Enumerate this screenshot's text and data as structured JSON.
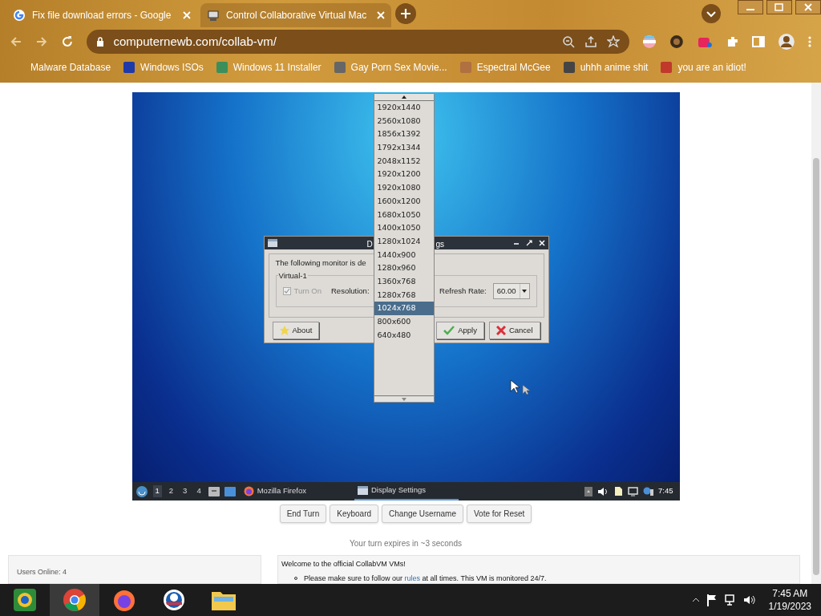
{
  "browser": {
    "tabs": [
      {
        "title": "Fix file download errors - Google",
        "selected": false
      },
      {
        "title": "Control Collaborative Virtual Mac",
        "selected": true
      }
    ],
    "url": "computernewb.com/collab-vm/",
    "bookmarks": [
      "Malware Database",
      "Windows ISOs",
      "Windows 11 Installer",
      "Gay Porn Sex Movie...",
      "Espectral McGee",
      "uhhh anime shit",
      "you are an idiot!"
    ]
  },
  "vm": {
    "dialog": {
      "title_fragments": [
        "D",
        "gs"
      ],
      "message": "The following monitor is de",
      "group": "Virtual-1",
      "turn_on": {
        "label": "Turn On",
        "checked": true,
        "disabled": true
      },
      "resolution_label": "Resolution:",
      "refresh_label": "Refresh Rate:",
      "refresh_value": "60.00",
      "buttons": [
        {
          "kind": "about",
          "label": "About"
        },
        {
          "kind": "apply",
          "label": "Apply"
        },
        {
          "kind": "cancel",
          "label": "Cancel"
        }
      ]
    },
    "resolution_list": [
      {
        "label": "1920x1440",
        "selected": false
      },
      {
        "label": "2560x1080",
        "selected": false
      },
      {
        "label": "1856x1392",
        "selected": false
      },
      {
        "label": "1792x1344",
        "selected": false
      },
      {
        "label": "2048x1152",
        "selected": false
      },
      {
        "label": "1920x1200",
        "selected": false
      },
      {
        "label": "1920x1080",
        "selected": false
      },
      {
        "label": "1600x1200",
        "selected": false
      },
      {
        "label": "1680x1050",
        "selected": false
      },
      {
        "label": "1400x1050",
        "selected": false
      },
      {
        "label": "1280x1024",
        "selected": false
      },
      {
        "label": "1440x900",
        "selected": false
      },
      {
        "label": "1280x960",
        "selected": false
      },
      {
        "label": "1360x768",
        "selected": false
      },
      {
        "label": "1280x768",
        "selected": false
      },
      {
        "label": "1024x768",
        "selected": true
      },
      {
        "label": "800x600",
        "selected": false
      },
      {
        "label": "640x480",
        "selected": false
      }
    ],
    "taskbar": {
      "workspaces": [
        {
          "label": "1",
          "selected": true
        },
        {
          "label": "2",
          "selected": false
        },
        {
          "label": "3",
          "selected": false
        },
        {
          "label": "4",
          "selected": false
        }
      ],
      "windows": [
        {
          "kind": "firefox",
          "label": "Mozilla Firefox",
          "selected": false
        },
        {
          "kind": "settings",
          "label": "Display Settings",
          "selected": true
        }
      ],
      "clock": "7:45"
    }
  },
  "controls": [
    "End Turn",
    "Keyboard",
    "Change Username",
    "Vote for Reset"
  ],
  "turn_notice": "Your turn expires in ~3 seconds",
  "users_online": "Users Online: 4",
  "chat": {
    "title": "Welcome to the official CollabVM VMs!",
    "rule_before": "Please make sure to follow our",
    "rule_link": "rules",
    "rule_after": "at all times. This VM is monitored 24/7."
  },
  "windows_taskbar": {
    "apps": [
      {
        "kind": "app",
        "selected": false
      },
      {
        "kind": "chrome",
        "selected": true
      },
      {
        "kind": "firefox",
        "selected": false
      },
      {
        "kind": "logo",
        "selected": false
      },
      {
        "kind": "folder",
        "selected": false
      }
    ],
    "time": "7:45 AM",
    "date": "1/19/2023"
  }
}
